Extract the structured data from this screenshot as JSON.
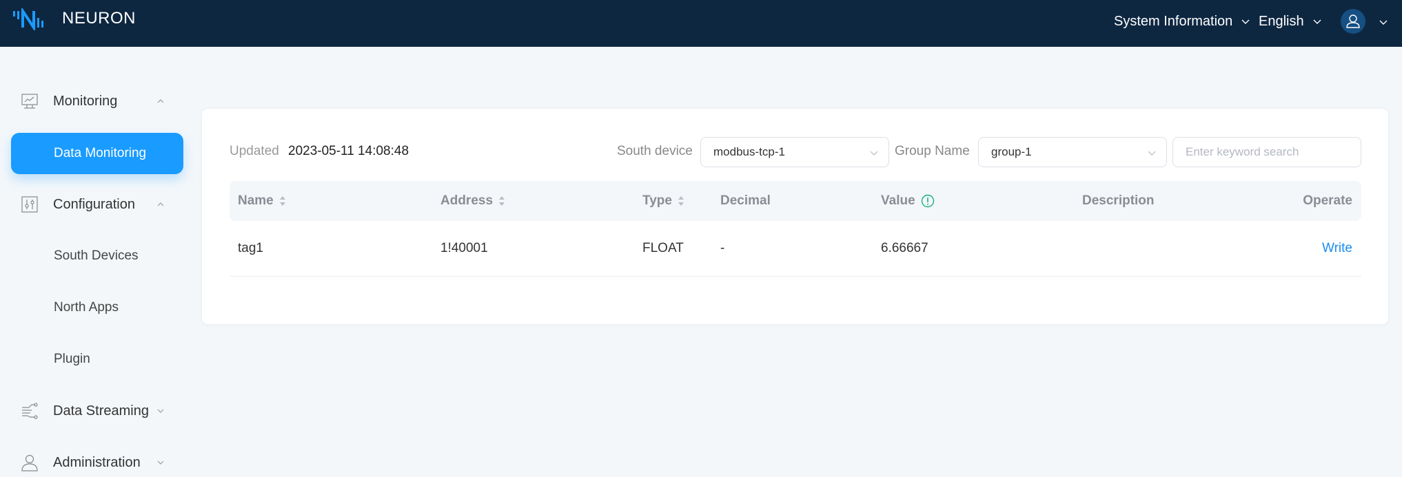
{
  "header": {
    "brand": "NEURON",
    "system_info": "System Information",
    "language": "English",
    "user_icon": "user-icon"
  },
  "sidebar": {
    "items": [
      {
        "label": "Monitoring",
        "icon": "monitor-chart-icon",
        "expanded": true
      },
      {
        "label": "Data Monitoring",
        "active": true
      },
      {
        "label": "Configuration",
        "icon": "sliders-icon",
        "expanded": true
      },
      {
        "label": "South Devices"
      },
      {
        "label": "North Apps"
      },
      {
        "label": "Plugin"
      },
      {
        "label": "Data Streaming",
        "icon": "circuit-icon",
        "expanded": false
      },
      {
        "label": "Administration",
        "icon": "user-icon",
        "expanded": false
      }
    ]
  },
  "main": {
    "updated_label": "Updated",
    "updated_value": "2023-05-11 14:08:48",
    "south_device_label": "South device",
    "south_device_value": "modbus-tcp-1",
    "group_name_label": "Group Name",
    "group_name_value": "group-1",
    "search_placeholder": "Enter keyword search",
    "table": {
      "columns": [
        "Name",
        "Address",
        "Type",
        "Decimal",
        "Value",
        "Description",
        "Operate"
      ],
      "rows": [
        {
          "name": "tag1",
          "address": "1!40001",
          "type": "FLOAT",
          "decimal": "-",
          "value": "6.66667",
          "description": "",
          "operate": "Write"
        }
      ]
    }
  },
  "colors": {
    "header_bg": "#0e2741",
    "accent": "#1a9bff",
    "link": "#1a8cf0",
    "info_icon": "#18b27a"
  }
}
